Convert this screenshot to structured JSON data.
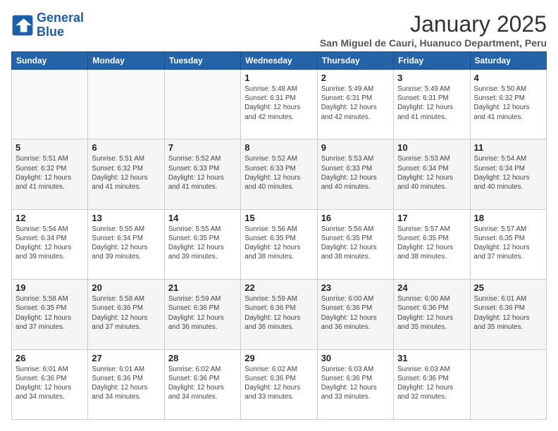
{
  "logo": {
    "line1": "General",
    "line2": "Blue"
  },
  "calendar": {
    "title": "January 2025",
    "subtitle": "San Miguel de Cauri, Huanuco Department, Peru",
    "days_of_week": [
      "Sunday",
      "Monday",
      "Tuesday",
      "Wednesday",
      "Thursday",
      "Friday",
      "Saturday"
    ],
    "weeks": [
      [
        {
          "num": "",
          "sunrise": "",
          "sunset": "",
          "daylight": ""
        },
        {
          "num": "",
          "sunrise": "",
          "sunset": "",
          "daylight": ""
        },
        {
          "num": "",
          "sunrise": "",
          "sunset": "",
          "daylight": ""
        },
        {
          "num": "1",
          "sunrise": "Sunrise: 5:48 AM",
          "sunset": "Sunset: 6:31 PM",
          "daylight": "Daylight: 12 hours and 42 minutes."
        },
        {
          "num": "2",
          "sunrise": "Sunrise: 5:49 AM",
          "sunset": "Sunset: 6:31 PM",
          "daylight": "Daylight: 12 hours and 42 minutes."
        },
        {
          "num": "3",
          "sunrise": "Sunrise: 5:49 AM",
          "sunset": "Sunset: 6:31 PM",
          "daylight": "Daylight: 12 hours and 41 minutes."
        },
        {
          "num": "4",
          "sunrise": "Sunrise: 5:50 AM",
          "sunset": "Sunset: 6:32 PM",
          "daylight": "Daylight: 12 hours and 41 minutes."
        }
      ],
      [
        {
          "num": "5",
          "sunrise": "Sunrise: 5:51 AM",
          "sunset": "Sunset: 6:32 PM",
          "daylight": "Daylight: 12 hours and 41 minutes."
        },
        {
          "num": "6",
          "sunrise": "Sunrise: 5:51 AM",
          "sunset": "Sunset: 6:32 PM",
          "daylight": "Daylight: 12 hours and 41 minutes."
        },
        {
          "num": "7",
          "sunrise": "Sunrise: 5:52 AM",
          "sunset": "Sunset: 6:33 PM",
          "daylight": "Daylight: 12 hours and 41 minutes."
        },
        {
          "num": "8",
          "sunrise": "Sunrise: 5:52 AM",
          "sunset": "Sunset: 6:33 PM",
          "daylight": "Daylight: 12 hours and 40 minutes."
        },
        {
          "num": "9",
          "sunrise": "Sunrise: 5:53 AM",
          "sunset": "Sunset: 6:33 PM",
          "daylight": "Daylight: 12 hours and 40 minutes."
        },
        {
          "num": "10",
          "sunrise": "Sunrise: 5:53 AM",
          "sunset": "Sunset: 6:34 PM",
          "daylight": "Daylight: 12 hours and 40 minutes."
        },
        {
          "num": "11",
          "sunrise": "Sunrise: 5:54 AM",
          "sunset": "Sunset: 6:34 PM",
          "daylight": "Daylight: 12 hours and 40 minutes."
        }
      ],
      [
        {
          "num": "12",
          "sunrise": "Sunrise: 5:54 AM",
          "sunset": "Sunset: 6:34 PM",
          "daylight": "Daylight: 12 hours and 39 minutes."
        },
        {
          "num": "13",
          "sunrise": "Sunrise: 5:55 AM",
          "sunset": "Sunset: 6:34 PM",
          "daylight": "Daylight: 12 hours and 39 minutes."
        },
        {
          "num": "14",
          "sunrise": "Sunrise: 5:55 AM",
          "sunset": "Sunset: 6:35 PM",
          "daylight": "Daylight: 12 hours and 39 minutes."
        },
        {
          "num": "15",
          "sunrise": "Sunrise: 5:56 AM",
          "sunset": "Sunset: 6:35 PM",
          "daylight": "Daylight: 12 hours and 38 minutes."
        },
        {
          "num": "16",
          "sunrise": "Sunrise: 5:56 AM",
          "sunset": "Sunset: 6:35 PM",
          "daylight": "Daylight: 12 hours and 38 minutes."
        },
        {
          "num": "17",
          "sunrise": "Sunrise: 5:57 AM",
          "sunset": "Sunset: 6:35 PM",
          "daylight": "Daylight: 12 hours and 38 minutes."
        },
        {
          "num": "18",
          "sunrise": "Sunrise: 5:57 AM",
          "sunset": "Sunset: 6:35 PM",
          "daylight": "Daylight: 12 hours and 37 minutes."
        }
      ],
      [
        {
          "num": "19",
          "sunrise": "Sunrise: 5:58 AM",
          "sunset": "Sunset: 6:35 PM",
          "daylight": "Daylight: 12 hours and 37 minutes."
        },
        {
          "num": "20",
          "sunrise": "Sunrise: 5:58 AM",
          "sunset": "Sunset: 6:36 PM",
          "daylight": "Daylight: 12 hours and 37 minutes."
        },
        {
          "num": "21",
          "sunrise": "Sunrise: 5:59 AM",
          "sunset": "Sunset: 6:36 PM",
          "daylight": "Daylight: 12 hours and 36 minutes."
        },
        {
          "num": "22",
          "sunrise": "Sunrise: 5:59 AM",
          "sunset": "Sunset: 6:36 PM",
          "daylight": "Daylight: 12 hours and 36 minutes."
        },
        {
          "num": "23",
          "sunrise": "Sunrise: 6:00 AM",
          "sunset": "Sunset: 6:36 PM",
          "daylight": "Daylight: 12 hours and 36 minutes."
        },
        {
          "num": "24",
          "sunrise": "Sunrise: 6:00 AM",
          "sunset": "Sunset: 6:36 PM",
          "daylight": "Daylight: 12 hours and 35 minutes."
        },
        {
          "num": "25",
          "sunrise": "Sunrise: 6:01 AM",
          "sunset": "Sunset: 6:36 PM",
          "daylight": "Daylight: 12 hours and 35 minutes."
        }
      ],
      [
        {
          "num": "26",
          "sunrise": "Sunrise: 6:01 AM",
          "sunset": "Sunset: 6:36 PM",
          "daylight": "Daylight: 12 hours and 34 minutes."
        },
        {
          "num": "27",
          "sunrise": "Sunrise: 6:01 AM",
          "sunset": "Sunset: 6:36 PM",
          "daylight": "Daylight: 12 hours and 34 minutes."
        },
        {
          "num": "28",
          "sunrise": "Sunrise: 6:02 AM",
          "sunset": "Sunset: 6:36 PM",
          "daylight": "Daylight: 12 hours and 34 minutes."
        },
        {
          "num": "29",
          "sunrise": "Sunrise: 6:02 AM",
          "sunset": "Sunset: 6:36 PM",
          "daylight": "Daylight: 12 hours and 33 minutes."
        },
        {
          "num": "30",
          "sunrise": "Sunrise: 6:03 AM",
          "sunset": "Sunset: 6:36 PM",
          "daylight": "Daylight: 12 hours and 33 minutes."
        },
        {
          "num": "31",
          "sunrise": "Sunrise: 6:03 AM",
          "sunset": "Sunset: 6:36 PM",
          "daylight": "Daylight: 12 hours and 32 minutes."
        },
        {
          "num": "",
          "sunrise": "",
          "sunset": "",
          "daylight": ""
        }
      ]
    ]
  }
}
